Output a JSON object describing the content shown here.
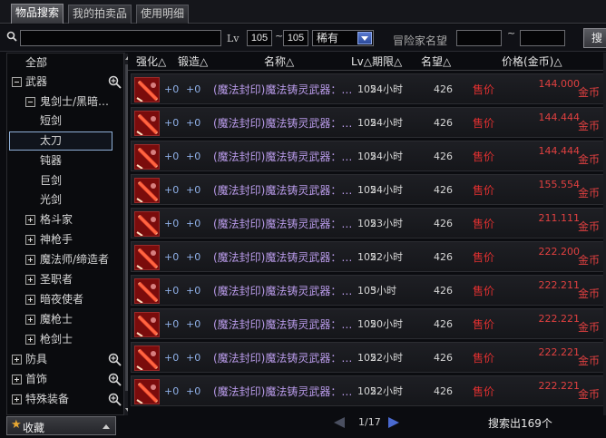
{
  "tabs": [
    {
      "label": "物品搜索",
      "active": true
    },
    {
      "label": "我的拍卖品",
      "active": false
    },
    {
      "label": "使用明细",
      "active": false
    }
  ],
  "search": {
    "input_value": "",
    "lv_label": "Lv",
    "lv_min": "105",
    "lv_max": "105",
    "tilde": "~",
    "rarity": "稀有",
    "fame_label": "冒险家名望",
    "fame_min": "",
    "fame_max": "",
    "search_button": "搜"
  },
  "tree": {
    "items": [
      {
        "label": "全部",
        "indent": 0,
        "toggle": "none",
        "zoom": false
      },
      {
        "label": "武器",
        "indent": 1,
        "toggle": "minus",
        "zoom": true
      },
      {
        "label": "鬼剑士/黑暗…",
        "indent": 2,
        "toggle": "minus",
        "zoom": false
      },
      {
        "label": "短剑",
        "indent": 3,
        "toggle": "none",
        "zoom": false
      },
      {
        "label": "太刀",
        "indent": 3,
        "toggle": "none",
        "zoom": false,
        "selected": true
      },
      {
        "label": "钝器",
        "indent": 3,
        "toggle": "none",
        "zoom": false
      },
      {
        "label": "巨剑",
        "indent": 3,
        "toggle": "none",
        "zoom": false
      },
      {
        "label": "光剑",
        "indent": 3,
        "toggle": "none",
        "zoom": false
      },
      {
        "label": "格斗家",
        "indent": 2,
        "toggle": "plus",
        "zoom": false
      },
      {
        "label": "神枪手",
        "indent": 2,
        "toggle": "plus",
        "zoom": false
      },
      {
        "label": "魔法师/缔造者",
        "indent": 2,
        "toggle": "plus",
        "zoom": false
      },
      {
        "label": "圣职者",
        "indent": 2,
        "toggle": "plus",
        "zoom": false
      },
      {
        "label": "暗夜使者",
        "indent": 2,
        "toggle": "plus",
        "zoom": false
      },
      {
        "label": "魔枪士",
        "indent": 2,
        "toggle": "plus",
        "zoom": false
      },
      {
        "label": "枪剑士",
        "indent": 2,
        "toggle": "plus",
        "zoom": false
      },
      {
        "label": "防具",
        "indent": 1,
        "toggle": "plus",
        "zoom": true
      },
      {
        "label": "首饰",
        "indent": 1,
        "toggle": "plus",
        "zoom": true
      },
      {
        "label": "特殊装备",
        "indent": 1,
        "toggle": "plus",
        "zoom": true
      }
    ],
    "favorites_label": "收藏"
  },
  "table": {
    "headers": [
      "强化△",
      "锻造△",
      "名称△",
      "Lv△期限△",
      "名望△",
      "价格(金币)△"
    ],
    "rows": [
      {
        "reinforce": "+0",
        "forge": "+0",
        "name": "(魔法封印)魔法铸灵武器：…",
        "lv": "105",
        "period": "24小时",
        "fame": "426",
        "sale": "售价",
        "price": "144.000",
        "unit": "金币"
      },
      {
        "reinforce": "+0",
        "forge": "+0",
        "name": "(魔法封印)魔法铸灵武器：…",
        "lv": "105",
        "period": "24小时",
        "fame": "426",
        "sale": "售价",
        "price": "144.444",
        "unit": "金币"
      },
      {
        "reinforce": "+0",
        "forge": "+0",
        "name": "(魔法封印)魔法铸灵武器：…",
        "lv": "105",
        "period": "24小时",
        "fame": "426",
        "sale": "售价",
        "price": "144.444",
        "unit": "金币"
      },
      {
        "reinforce": "+0",
        "forge": "+0",
        "name": "(魔法封印)魔法铸灵武器：…",
        "lv": "105",
        "period": "24小时",
        "fame": "426",
        "sale": "售价",
        "price": "155.554",
        "unit": "金币"
      },
      {
        "reinforce": "+0",
        "forge": "+0",
        "name": "(魔法封印)魔法铸灵武器：…",
        "lv": "105",
        "period": "23小时",
        "fame": "426",
        "sale": "售价",
        "price": "211.111",
        "unit": "金币"
      },
      {
        "reinforce": "+0",
        "forge": "+0",
        "name": "(魔法封印)魔法铸灵武器：…",
        "lv": "105",
        "period": "22小时",
        "fame": "426",
        "sale": "售价",
        "price": "222.200",
        "unit": "金币"
      },
      {
        "reinforce": "+0",
        "forge": "+0",
        "name": "(魔法封印)魔法铸灵武器：…",
        "lv": "105",
        "period": "3小时",
        "fame": "426",
        "sale": "售价",
        "price": "222.211",
        "unit": "金币"
      },
      {
        "reinforce": "+0",
        "forge": "+0",
        "name": "(魔法封印)魔法铸灵武器：…",
        "lv": "105",
        "period": "20小时",
        "fame": "426",
        "sale": "售价",
        "price": "222.221",
        "unit": "金币"
      },
      {
        "reinforce": "+0",
        "forge": "+0",
        "name": "(魔法封印)魔法铸灵武器：…",
        "lv": "105",
        "period": "22小时",
        "fame": "426",
        "sale": "售价",
        "price": "222.221",
        "unit": "金币"
      },
      {
        "reinforce": "+0",
        "forge": "+0",
        "name": "(魔法封印)魔法铸灵武器：…",
        "lv": "105",
        "period": "22小时",
        "fame": "426",
        "sale": "售价",
        "price": "222.221",
        "unit": "金币"
      }
    ]
  },
  "pagination": {
    "page_text": "1/17",
    "result_count": "搜索出169个"
  },
  "colors": {
    "price_red": "#e04040",
    "name_purple": "#b89ae8",
    "plus_blue": "#8fb0e8",
    "accent_blue": "#4a6ad0"
  }
}
